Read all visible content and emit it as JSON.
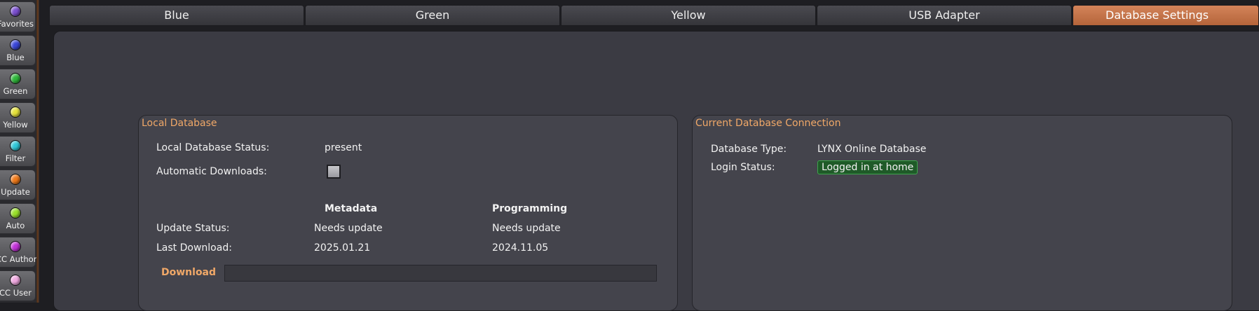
{
  "sidebar": {
    "items": [
      {
        "label": "Favorites",
        "color": "#7b4fd0"
      },
      {
        "label": "Blue",
        "color": "#3a46d8"
      },
      {
        "label": "Green",
        "color": "#2fb83a"
      },
      {
        "label": "Yellow",
        "color": "#e6e23a"
      },
      {
        "label": "Filter",
        "color": "#2fc8d8"
      },
      {
        "label": "Update",
        "color": "#f07a1a"
      },
      {
        "label": "Auto",
        "color": "#9ae02a"
      },
      {
        "label": "CC Author",
        "color": "#c232d8"
      },
      {
        "label": "CC User",
        "color": "#f0a8e0"
      }
    ]
  },
  "tabs": [
    {
      "label": "Blue",
      "active": false
    },
    {
      "label": "Green",
      "active": false
    },
    {
      "label": "Yellow",
      "active": false
    },
    {
      "label": "USB Adapter",
      "active": false
    },
    {
      "label": "Database Settings",
      "active": true
    }
  ],
  "local_db": {
    "title": "Local Database",
    "status_label": "Local Database Status:",
    "status_value": "present",
    "auto_label": "Automatic Downloads:",
    "auto_checked": false,
    "col_metadata": "Metadata",
    "col_programming": "Programming",
    "update_label": "Update Status:",
    "update_metadata": "Needs update",
    "update_programming": "Needs update",
    "last_label": "Last Download:",
    "last_metadata": "2025.01.21",
    "last_programming": "2024.11.05",
    "download_label": "Download",
    "download_progress": 0
  },
  "connection": {
    "title": "Current Database Connection",
    "type_label": "Database Type:",
    "type_value": "LYNX Online Database",
    "login_label": "Login Status:",
    "login_value": "Logged in at home"
  },
  "colors": {
    "accent": "#f0a868",
    "active_tab": "#c87448",
    "login_badge_bg": "#1f5a28"
  }
}
